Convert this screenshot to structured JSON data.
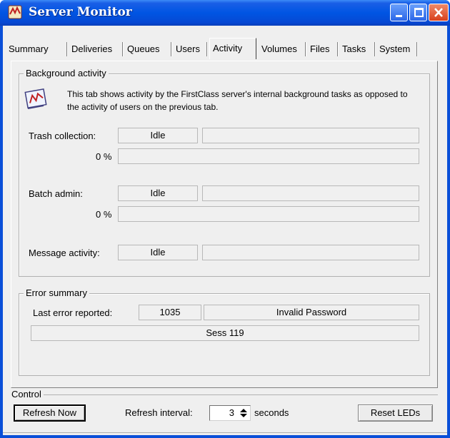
{
  "window": {
    "title": "Server Monitor"
  },
  "tabs": [
    {
      "label": "Summary"
    },
    {
      "label": "Deliveries"
    },
    {
      "label": "Queues"
    },
    {
      "label": "Users"
    },
    {
      "label": "Activity",
      "active": true
    },
    {
      "label": "Volumes"
    },
    {
      "label": "Files"
    },
    {
      "label": "Tasks"
    },
    {
      "label": "System"
    }
  ],
  "background": {
    "group_title": "Background activity",
    "description": "This tab shows activity by the FirstClass server's internal background tasks as opposed to the activity of users on the previous tab.",
    "trash": {
      "label": "Trash collection:",
      "status": "Idle",
      "detail": "",
      "percent": "0 %",
      "progress_fraction": 0
    },
    "batch": {
      "label": "Batch admin:",
      "status": "Idle",
      "detail": "",
      "percent": "0 %",
      "progress_fraction": 0
    },
    "message": {
      "label": "Message activity:",
      "status": "Idle",
      "detail": ""
    }
  },
  "errors": {
    "group_title": "Error summary",
    "last_label": "Last error reported:",
    "code": "1035",
    "message": "Invalid Password",
    "session": "Sess 119"
  },
  "control": {
    "group_title": "Control",
    "refresh_now": "Refresh Now",
    "interval_label": "Refresh interval:",
    "interval_value": "3",
    "interval_unit": "seconds",
    "reset_leds": "Reset LEDs"
  },
  "colors": {
    "titlebar": "#0055e3",
    "face": "#efefef",
    "close": "#d8401a"
  }
}
